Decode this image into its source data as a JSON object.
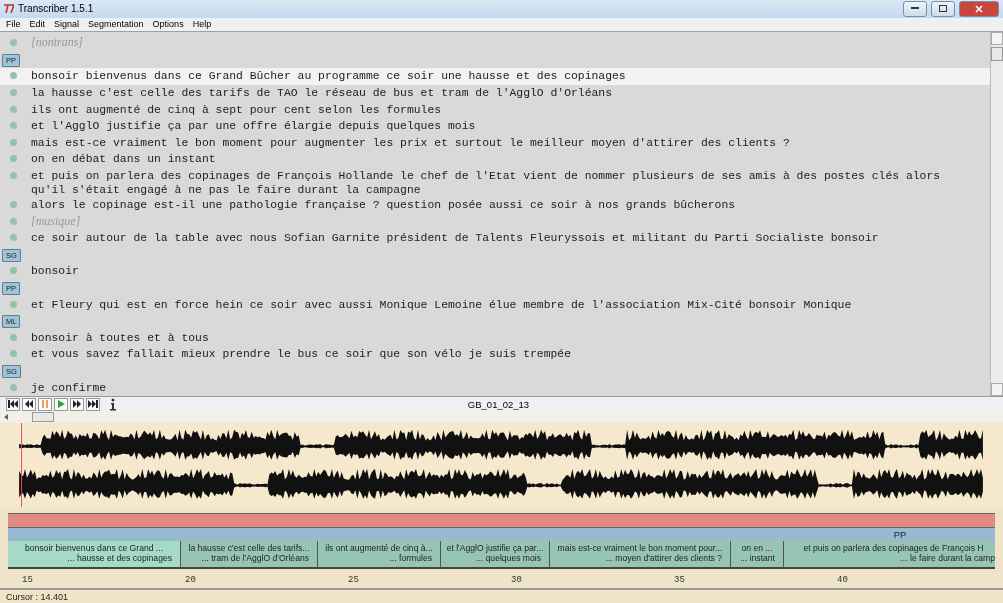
{
  "window": {
    "title": "Transcriber 1.5.1"
  },
  "menu": [
    "File",
    "Edit",
    "Signal",
    "Segmentation",
    "Options",
    "Help"
  ],
  "transcript": [
    {
      "kind": "event",
      "text": "[nontrans]"
    },
    {
      "kind": "speaker",
      "label": "PP"
    },
    {
      "kind": "line",
      "text": "bonsoir bienvenus dans ce Grand Bûcher au programme ce soir une hausse et des copinages",
      "selected": true
    },
    {
      "kind": "line",
      "text": "la hausse c'est celle des tarifs de TAO le réseau de bus et tram de l'AgglO d'Orléans",
      "selected": false
    },
    {
      "kind": "line",
      "text": "ils ont augmenté de cinq à sept pour cent selon les formules",
      "selected": false
    },
    {
      "kind": "line",
      "text": "et l'AgglO justifie ça par une offre élargie depuis quelques mois",
      "selected": false
    },
    {
      "kind": "line",
      "text": "mais est-ce vraiment le bon moment pour augmenter les prix et surtout le meilleur moyen d'attirer des clients ?",
      "selected": false
    },
    {
      "kind": "line",
      "text": "on en débat dans un instant",
      "selected": false
    },
    {
      "kind": "line",
      "text": "et puis on parlera des copinages de François Hollande le chef de l'Etat vient de nommer plusieurs de ses amis à des postes clés alors qu'il s'était engagé à ne pas le faire durant la campagne",
      "selected": false
    },
    {
      "kind": "line",
      "text": "alors le copinage est-il une pathologie française ? question posée aussi ce soir à nos grands bûcherons",
      "selected": false
    },
    {
      "kind": "event",
      "text": "[musique]"
    },
    {
      "kind": "line",
      "text": "ce soir autour de la table avec nous Sofian Garnite président de Talents Fleuryssois et militant du Parti Socialiste bonsoir",
      "selected": false
    },
    {
      "kind": "speaker",
      "label": "SG"
    },
    {
      "kind": "line",
      "text": "bonsoir",
      "selected": false
    },
    {
      "kind": "speaker",
      "label": "PP"
    },
    {
      "kind": "line",
      "text": "et Fleury qui est en force hein ce soir avec aussi Monique Lemoine élue membre de l'association Mix-Cité bonsoir Monique",
      "selected": false
    },
    {
      "kind": "speaker",
      "label": "ML"
    },
    {
      "kind": "line",
      "text": "bonsoir à toutes et à tous",
      "selected": false
    },
    {
      "kind": "line",
      "text": "et vous savez fallait mieux prendre le bus ce soir que son vélo je suis trempée",
      "selected": false
    },
    {
      "kind": "speaker",
      "label": "SG"
    },
    {
      "kind": "line",
      "text": "je confirme",
      "selected": false
    }
  ],
  "player": {
    "file": "GB_01_02_13"
  },
  "tiers": {
    "speaker_bar": {
      "label": "PP"
    },
    "segments": [
      {
        "line_1": "bonsoir bienvenus dans ce Grand ...",
        "line_2": "... hausse et des copinages",
        "selected": true
      },
      {
        "line_1": "la hausse c'est celle des tarifs...",
        "line_2": "... tram de l'AgglO d'Orléans",
        "selected": false
      },
      {
        "line_1": "ils ont augmenté de cinq à...",
        "line_2": "... formules",
        "selected": false
      },
      {
        "line_1": "et l'AgglO justifie ça par...",
        "line_2": "... quelques mois",
        "selected": false
      },
      {
        "line_1": "mais est-ce vraiment le bon moment pour...",
        "line_2": "... moyen d'attirer des clients ?",
        "selected": false
      },
      {
        "line_1": "on en ...",
        "line_2": "... instant",
        "selected": false
      },
      {
        "line_1": "et puis on parlera des copinages de François H",
        "line_2": "... le faire durant la camp",
        "selected": false
      }
    ]
  },
  "ruler": [
    "15",
    "20",
    "25",
    "30",
    "35",
    "40"
  ],
  "status": {
    "cursor": "Cursor : 14.401"
  }
}
